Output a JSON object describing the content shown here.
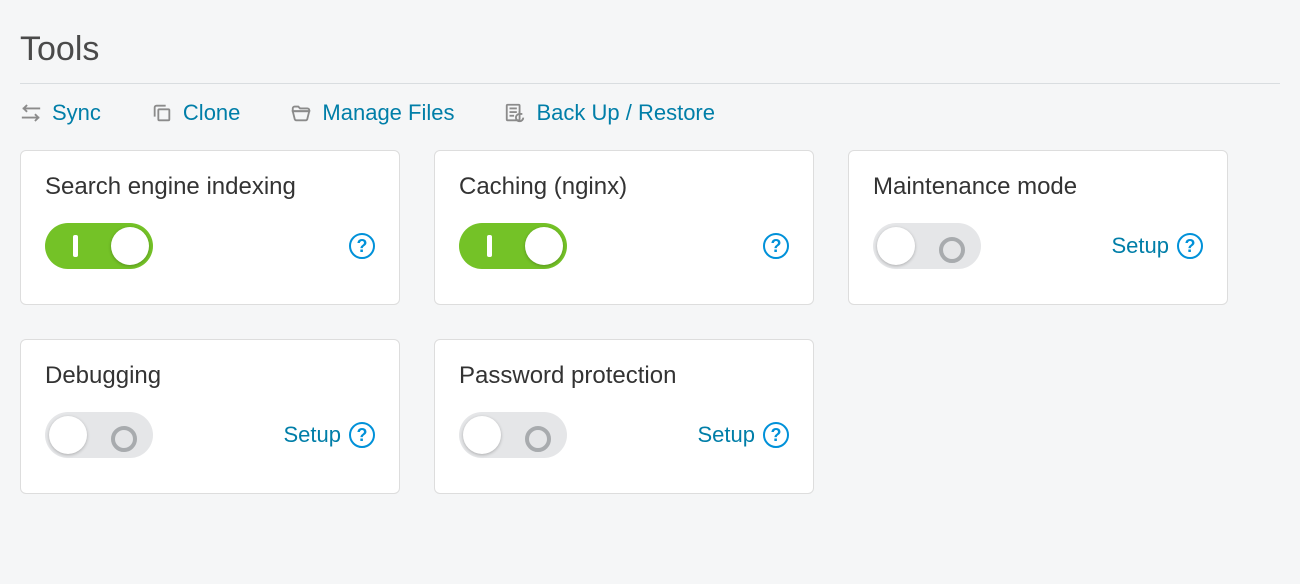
{
  "title": "Tools",
  "toolbar": {
    "sync": {
      "label": "Sync"
    },
    "clone": {
      "label": "Clone"
    },
    "files": {
      "label": "Manage Files"
    },
    "backup": {
      "label": "Back Up / Restore"
    }
  },
  "setup_label": "Setup",
  "cards": [
    {
      "id": "search-indexing",
      "title": "Search engine indexing",
      "state": "on",
      "has_setup": false
    },
    {
      "id": "caching",
      "title": "Caching (nginx)",
      "state": "on",
      "has_setup": false
    },
    {
      "id": "maintenance-mode",
      "title": "Maintenance mode",
      "state": "off",
      "has_setup": true
    },
    {
      "id": "debugging",
      "title": "Debugging",
      "state": "off",
      "has_setup": true
    },
    {
      "id": "password-protection",
      "title": "Password protection",
      "state": "off",
      "has_setup": true
    }
  ],
  "colors": {
    "accent_link": "#007ea8",
    "accent_help": "#0091d9",
    "toggle_on": "#74c227"
  }
}
